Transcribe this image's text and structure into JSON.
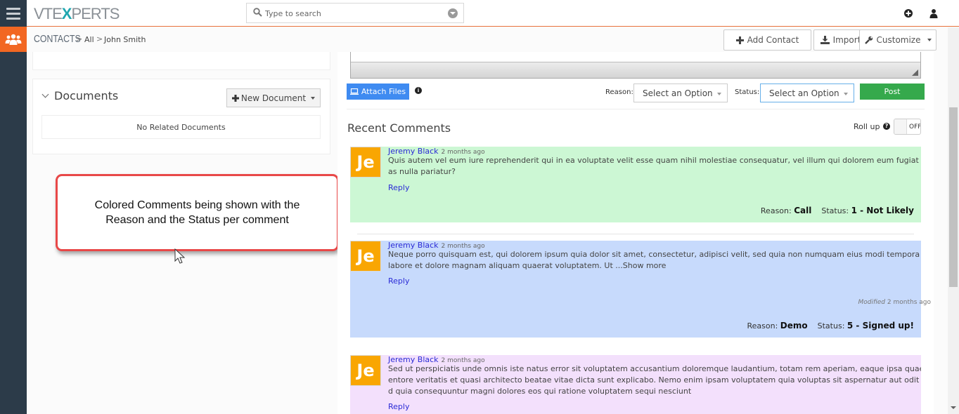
{
  "topbar": {
    "logo_prefix": "VTE",
    "logo_x": "X",
    "logo_suffix": "PERTS",
    "search_placeholder": "Type to search",
    "icons": [
      "menu-icon",
      "search-icon",
      "dropdown-icon",
      "plus-circle-icon",
      "user-icon",
      "contacts-module-icon"
    ]
  },
  "breadcrumb": {
    "module": "CONTACTS",
    "sep": ">",
    "filter": "All",
    "record": "John Smith"
  },
  "actions": {
    "add_contact": "Add Contact",
    "import": "Import",
    "customize": "Customize"
  },
  "documents": {
    "title": "Documents",
    "new_button": "New Document",
    "empty": "No Related Documents"
  },
  "callout": {
    "text": "Colored Comments being shown with the Reason and the Status per comment"
  },
  "composer": {
    "attach": "Attach Files",
    "reason_label": "Reason:",
    "reason_value": "Select an Option",
    "status_label": "Status:",
    "status_value": "Select an Option",
    "post": "Post"
  },
  "comments_section": {
    "title": "Recent Comments",
    "rollup_label": "Roll up",
    "rollup_state": "OFF"
  },
  "comments": [
    {
      "initials": "Je",
      "author": "Jeremy Black",
      "time": "2 months ago",
      "lines": [
        "Quis autem vel eum iure reprehenderit qui in ea voluptate velit esse quam nihil molestiae consequatur, vel illum qui dolorem eum fugiat quo volupt",
        "as nulla pariatur?"
      ],
      "reply": "Reply",
      "reason_label": "Reason:",
      "reason": "Call",
      "status_label": "Status:",
      "status": "1 - Not Likely",
      "color": "#ccf7d4"
    },
    {
      "initials": "Je",
      "author": "Jeremy Black",
      "time": "2 months ago",
      "lines": [
        "Neque porro quisquam est, qui dolorem ipsum quia dolor sit amet, consectetur, adipisci velit, sed quia non numquam eius modi tempora incidunt ut",
        "labore et dolore magnam aliquam quaerat voluptatem. Ut ...Show more"
      ],
      "reply": "Reply",
      "modified_label": "Modified",
      "modified_time": "2 months ago",
      "reason_label": "Reason:",
      "reason": "Demo",
      "status_label": "Status:",
      "status": "5 - Signed up!",
      "color": "#c7dafc"
    },
    {
      "initials": "Je",
      "author": "Jeremy Black",
      "time": "2 months ago",
      "lines": [
        "Sed ut perspiciatis unde omnis iste natus error sit voluptatem accusantium doloremque laudantium, totam rem aperiam, eaque ipsa quae ab illo inv",
        "entore veritatis et quasi architecto beatae vitae dicta sunt explicabo. Nemo enim ipsam voluptatem quia voluptas sit aspernatur aut odit aut fugit, se",
        "d quia consequuntur magni dolores eos qui ratione voluptatem sequi nesciunt"
      ],
      "reply": "Reply",
      "color": "#f3e0fc"
    }
  ],
  "colors": {
    "accent_orange": "#f26722",
    "rail": "#2c3b49",
    "attach_blue": "#3f8bf1",
    "post_green": "#35a94c",
    "callout_border": "#e84848",
    "avatar": "#f9a602"
  }
}
